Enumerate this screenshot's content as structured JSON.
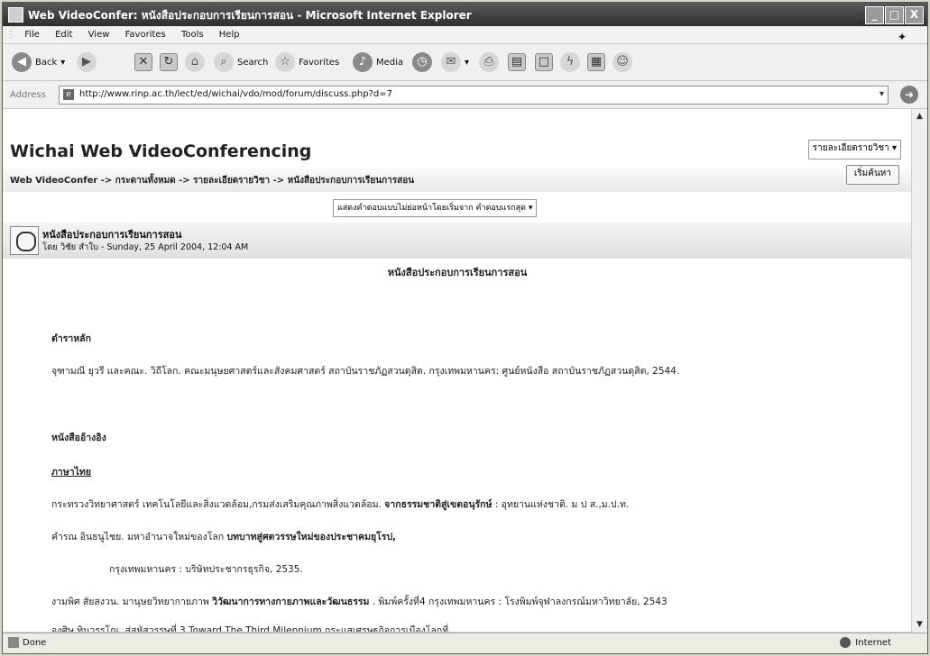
{
  "window": {
    "title": "Web VideoConfer: หนังสือประกอบการเรียนการสอน - Microsoft Internet Explorer",
    "controls": {
      "minimize": "_",
      "maximize": "□",
      "close": "X"
    }
  },
  "menu": [
    "File",
    "Edit",
    "View",
    "Favorites",
    "Tools",
    "Help"
  ],
  "toolbar": {
    "back": "Back",
    "search": "Search",
    "favorites": "Favorites",
    "media": "Media"
  },
  "address": {
    "label": "Address",
    "url": "http://www.rinp.ac.th/lect/ed/wichai/vdo/mod/forum/discuss.php?d=7"
  },
  "page": {
    "site_title": "Wichai Web VideoConferencing",
    "breadcrumb": "Web VideoConfer -> กระดานทั้งหมด -> รายละเอียดรายวิชา -> หนังสือประกอบการเรียนการสอน",
    "jump_select": "รายละเอียดรายวิชา",
    "search_button": "เริ่มค้นหา",
    "display_mode": "แสดงคำตอบแบบไม่ย่อหน้าโดยเริ่มจาก คำตอบแรกสุด",
    "post": {
      "title": "หนังสือประกอบการเรียนการสอน",
      "byline": "โดย วิชัย สำใบ - Sunday, 25 April 2004, 12:04 AM",
      "heading": "หนังสือประกอบการเรียนการสอน",
      "textbook_label": "ตำราหลัก",
      "textbook_ref": "จุฑามณี ยุวรี และคณะ. วิถีโลก. คณะมนุษยศาสตร์และสังคมศาสตร์ สถาบันราชภัฏสวนดุสิต. กรุงเทพมหานคร: ศูนย์หนังสือ สถาบันราชภัฏสวนดุสิต, 2544.",
      "refs_label": "หนังสืออ้างอิง",
      "thai_label": "ภาษาไทย",
      "ref1_a": "กระทรวงวิทยาศาสตร์ เทคโนโลยีและสิ่งแวดล้อม,กรมส่งเสริมคุณภาพสิ่งแวดล้อม.",
      "ref1_b": "จากธรรมชาติสู่เขตอนุรักษ์",
      "ref1_c": ": อุทยานแห่งชาติ. ม ป ส.,ม.ป.ท.",
      "ref2_a": "คำรณ อินธนูไชย. มหาอำนาจใหม่ของโลก",
      "ref2_b": "บทบาทสู่ศตวรรษใหม่ของประชาคมยุโรป,",
      "ref2_c": "กรุงเทพมหานคร : บริษัทประชากรธุรกิจ, 2535.",
      "ref3_a": "งามพิศ สัยสงวน. มานุษยวิทยากายภาพ",
      "ref3_b": "วิวัฒนาการทางกายภาพและวัฒนธรรม",
      "ref3_c": ". พิมพ์ครั้งที่4 กรุงเทพมหานคร : โรงพิมพ์จุฬาลงกรณ์มหาวิทยาลัย, 2543",
      "ref4": "จงศิษ ทินวรรโณ. สู่สหัสวรรษที่ 3 Toward The Third Milennium กระแสเศรษฐกิจการเมืองโลกที่"
    }
  },
  "status": {
    "left": "Done",
    "zone": "Internet"
  }
}
